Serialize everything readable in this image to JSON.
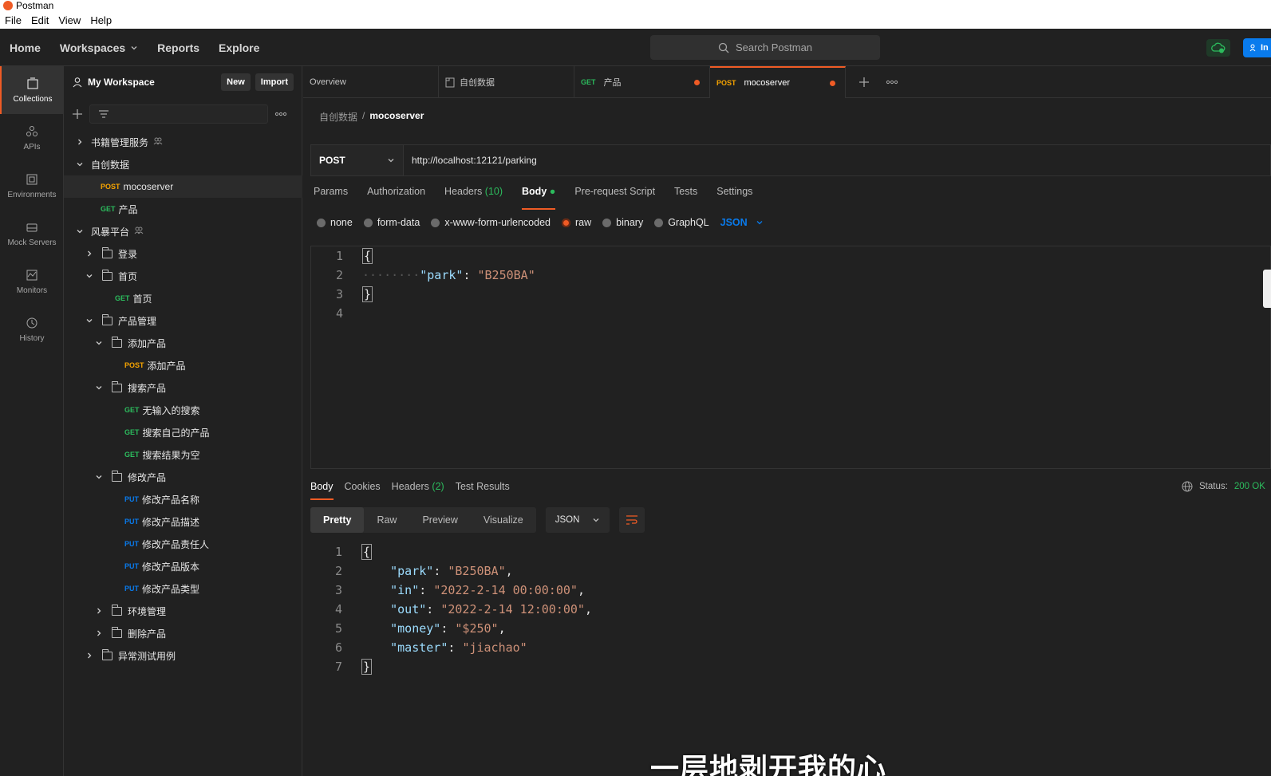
{
  "window": {
    "title": "Postman",
    "menu": [
      "File",
      "Edit",
      "View",
      "Help"
    ]
  },
  "header": {
    "nav": {
      "home": "Home",
      "workspaces": "Workspaces",
      "reports": "Reports",
      "explore": "Explore"
    },
    "search_placeholder": "Search Postman",
    "invite_label": "In"
  },
  "iconbar": [
    {
      "label": "Collections",
      "icon": "collections-icon",
      "active": true
    },
    {
      "label": "APIs",
      "icon": "apis-icon"
    },
    {
      "label": "Environments",
      "icon": "environments-icon"
    },
    {
      "label": "Mock Servers",
      "icon": "mock-servers-icon"
    },
    {
      "label": "Monitors",
      "icon": "monitors-icon"
    },
    {
      "label": "History",
      "icon": "history-icon"
    }
  ],
  "sidebar": {
    "workspace_name": "My Workspace",
    "new_label": "New",
    "import_label": "Import",
    "tree": [
      {
        "label": "书籍管理服务",
        "kind": "collection",
        "depth": 0,
        "expanded": false,
        "shared": true
      },
      {
        "label": "自创数据",
        "kind": "collection",
        "depth": 0,
        "expanded": true
      },
      {
        "label": "mocoserver",
        "kind": "request",
        "method": "POST",
        "depth": 1,
        "selected": true
      },
      {
        "label": "产品",
        "kind": "request",
        "method": "GET",
        "depth": 1
      },
      {
        "label": "风暴平台",
        "kind": "collection",
        "depth": 0,
        "expanded": true,
        "shared": true
      },
      {
        "label": "登录",
        "kind": "folder",
        "depth": 1,
        "expanded": false
      },
      {
        "label": "首页",
        "kind": "folder",
        "depth": 1,
        "expanded": true
      },
      {
        "label": "首页",
        "kind": "request",
        "method": "GET",
        "depth": 2
      },
      {
        "label": "产品管理",
        "kind": "folder",
        "depth": 1,
        "expanded": true
      },
      {
        "label": "添加产品",
        "kind": "folder",
        "depth": 2,
        "expanded": true
      },
      {
        "label": "添加产品",
        "kind": "request",
        "method": "POST",
        "depth": 3
      },
      {
        "label": "搜索产品",
        "kind": "folder",
        "depth": 2,
        "expanded": true
      },
      {
        "label": "无输入的搜索",
        "kind": "request",
        "method": "GET",
        "depth": 3
      },
      {
        "label": "搜索自己的产品",
        "kind": "request",
        "method": "GET",
        "depth": 3
      },
      {
        "label": "搜索结果为空",
        "kind": "request",
        "method": "GET",
        "depth": 3
      },
      {
        "label": "修改产品",
        "kind": "folder",
        "depth": 2,
        "expanded": true
      },
      {
        "label": "修改产品名称",
        "kind": "request",
        "method": "PUT",
        "depth": 3
      },
      {
        "label": "修改产品描述",
        "kind": "request",
        "method": "PUT",
        "depth": 3
      },
      {
        "label": "修改产品责任人",
        "kind": "request",
        "method": "PUT",
        "depth": 3
      },
      {
        "label": "修改产品版本",
        "kind": "request",
        "method": "PUT",
        "depth": 3
      },
      {
        "label": "修改产品类型",
        "kind": "request",
        "method": "PUT",
        "depth": 3
      },
      {
        "label": "环境管理",
        "kind": "folder",
        "depth": 2,
        "expanded": false
      },
      {
        "label": "删除产品",
        "kind": "folder",
        "depth": 2,
        "expanded": false
      },
      {
        "label": "异常测试用例",
        "kind": "folder",
        "depth": 1,
        "expanded": false
      }
    ]
  },
  "tabs": [
    {
      "label": "Overview",
      "method": ""
    },
    {
      "label": "自创数据",
      "method": "",
      "doc": true
    },
    {
      "label": "产品",
      "method": "GET",
      "unsaved": true
    },
    {
      "label": "mocoserver",
      "method": "POST",
      "unsaved": true,
      "active": true
    }
  ],
  "breadcrumb": {
    "parent": "自创数据",
    "sep": "/",
    "current": "mocoserver"
  },
  "request": {
    "method": "POST",
    "url": "http://localhost:12121/parking",
    "tabs": {
      "params": "Params",
      "authorization": "Authorization",
      "headers": "Headers",
      "headers_count": "(10)",
      "body": "Body",
      "prerequest": "Pre-request Script",
      "tests": "Tests",
      "settings": "Settings"
    },
    "body_types": [
      "none",
      "form-data",
      "x-www-form-urlencoded",
      "raw",
      "binary",
      "GraphQL"
    ],
    "body_type_selected": "raw",
    "format": "JSON",
    "body_lines": [
      {
        "n": "1",
        "parts": [
          [
            "brace",
            "{"
          ]
        ]
      },
      {
        "n": "2",
        "parts": [
          [
            "ws",
            "········"
          ],
          [
            "key",
            "\"park\""
          ],
          [
            "punc",
            ": "
          ],
          [
            "str",
            "\"B250BA\""
          ]
        ]
      },
      {
        "n": "3",
        "parts": [
          [
            "brace",
            "}"
          ]
        ]
      },
      {
        "n": "4",
        "parts": []
      }
    ]
  },
  "response": {
    "tabs": {
      "body": "Body",
      "cookies": "Cookies",
      "headers": "Headers",
      "headers_count": "(2)",
      "test_results": "Test Results"
    },
    "status_label": "Status:",
    "status_value": "200 OK",
    "views": {
      "pretty": "Pretty",
      "raw": "Raw",
      "preview": "Preview",
      "visualize": "Visualize"
    },
    "format": "JSON",
    "body_lines": [
      {
        "n": "1",
        "parts": [
          [
            "brace",
            "{"
          ]
        ]
      },
      {
        "n": "2",
        "parts": [
          [
            "ws",
            "    "
          ],
          [
            "key",
            "\"park\""
          ],
          [
            "punc",
            ": "
          ],
          [
            "str",
            "\"B250BA\""
          ],
          [
            "punc",
            ","
          ]
        ]
      },
      {
        "n": "3",
        "parts": [
          [
            "ws",
            "    "
          ],
          [
            "key",
            "\"in\""
          ],
          [
            "punc",
            ": "
          ],
          [
            "str",
            "\"2022-2-14 00:00:00\""
          ],
          [
            "punc",
            ","
          ]
        ]
      },
      {
        "n": "4",
        "parts": [
          [
            "ws",
            "    "
          ],
          [
            "key",
            "\"out\""
          ],
          [
            "punc",
            ": "
          ],
          [
            "str",
            "\"2022-2-14 12:00:00\""
          ],
          [
            "punc",
            ","
          ]
        ]
      },
      {
        "n": "5",
        "parts": [
          [
            "ws",
            "    "
          ],
          [
            "key",
            "\"money\""
          ],
          [
            "punc",
            ": "
          ],
          [
            "str",
            "\"$250\""
          ],
          [
            "punc",
            ","
          ]
        ]
      },
      {
        "n": "6",
        "parts": [
          [
            "ws",
            "    "
          ],
          [
            "key",
            "\"master\""
          ],
          [
            "punc",
            ": "
          ],
          [
            "str",
            "\"jiachao\""
          ]
        ]
      },
      {
        "n": "7",
        "parts": [
          [
            "brace",
            "}"
          ]
        ]
      }
    ]
  },
  "overlay_subtitle": "一层地剥开我的心",
  "colors": {
    "accent": "#ef5b25",
    "get": "#2cbb5d",
    "post": "#f5a300",
    "put": "#097bed",
    "ok": "#2cbb5d"
  }
}
